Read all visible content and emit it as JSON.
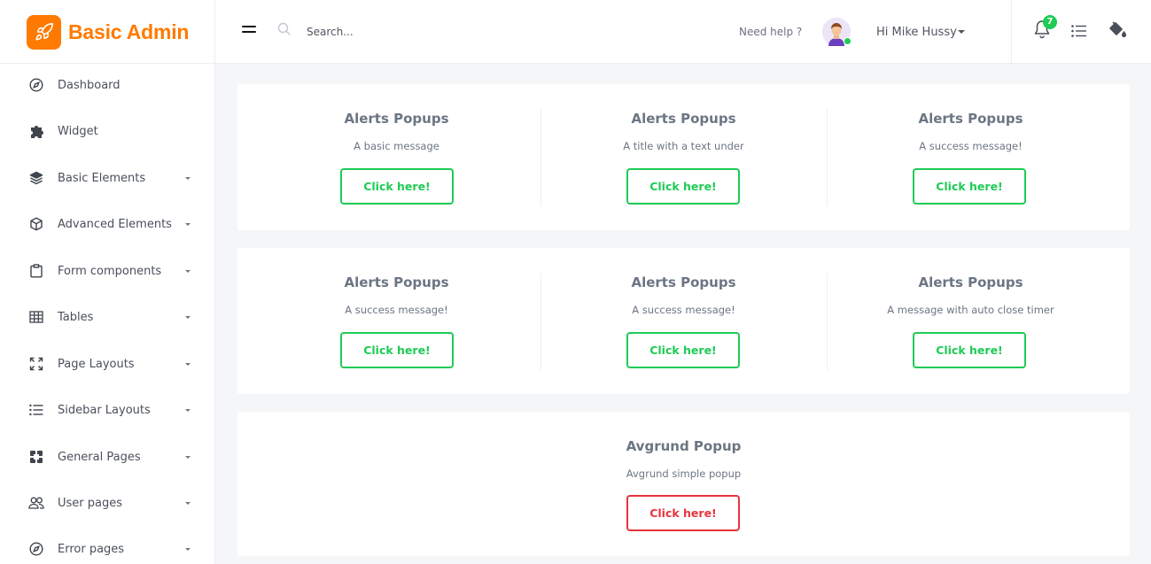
{
  "brand": {
    "name": "Basic Admin",
    "color": "#ff7a00"
  },
  "search": {
    "placeholder": "Search..."
  },
  "header": {
    "need_help": "Need help ?",
    "user_greeting": "Hi Mike Hussy",
    "notifications_count": "7",
    "icons": [
      "menu-icon",
      "search-icon",
      "bell-icon",
      "list-icon",
      "paint-bucket-icon"
    ]
  },
  "sidebar": {
    "items": [
      {
        "label": "Dashboard",
        "icon": "compass-icon",
        "has_submenu": false
      },
      {
        "label": "Widget",
        "icon": "puzzle-icon",
        "has_submenu": false
      },
      {
        "label": "Basic Elements",
        "icon": "layers-icon",
        "has_submenu": true
      },
      {
        "label": "Advanced Elements",
        "icon": "cube-icon",
        "has_submenu": true
      },
      {
        "label": "Form components",
        "icon": "clipboard-icon",
        "has_submenu": true
      },
      {
        "label": "Tables",
        "icon": "table-icon",
        "has_submenu": true
      },
      {
        "label": "Page Layouts",
        "icon": "expand-icon",
        "has_submenu": true
      },
      {
        "label": "Sidebar Layouts",
        "icon": "list-icon",
        "has_submenu": true
      },
      {
        "label": "General Pages",
        "icon": "frame-icon",
        "has_submenu": true
      },
      {
        "label": "User pages",
        "icon": "users-icon",
        "has_submenu": true
      },
      {
        "label": "Error pages",
        "icon": "compass-icon",
        "has_submenu": true
      }
    ]
  },
  "cards": [
    {
      "items": [
        {
          "title": "Alerts Popups",
          "subtitle": "A basic message",
          "button": "Click here!"
        },
        {
          "title": "Alerts Popups",
          "subtitle": "A title with a text under",
          "button": "Click here!"
        },
        {
          "title": "Alerts Popups",
          "subtitle": "A success message!",
          "button": "Click here!"
        }
      ]
    },
    {
      "items": [
        {
          "title": "Alerts Popups",
          "subtitle": "A success message!",
          "button": "Click here!"
        },
        {
          "title": "Alerts Popups",
          "subtitle": "A success message!",
          "button": "Click here!"
        },
        {
          "title": "Alerts Popups",
          "subtitle": "A message with auto close timer",
          "button": "Click here!"
        }
      ]
    },
    {
      "items": [
        {
          "title": "Avgrund Popup",
          "subtitle": "Avgrund simple popup",
          "button": "Click here!"
        }
      ]
    }
  ],
  "colors": {
    "accent_green": "#1ecb55",
    "accent_red": "#e8343c",
    "brand_orange": "#ff7a00"
  }
}
